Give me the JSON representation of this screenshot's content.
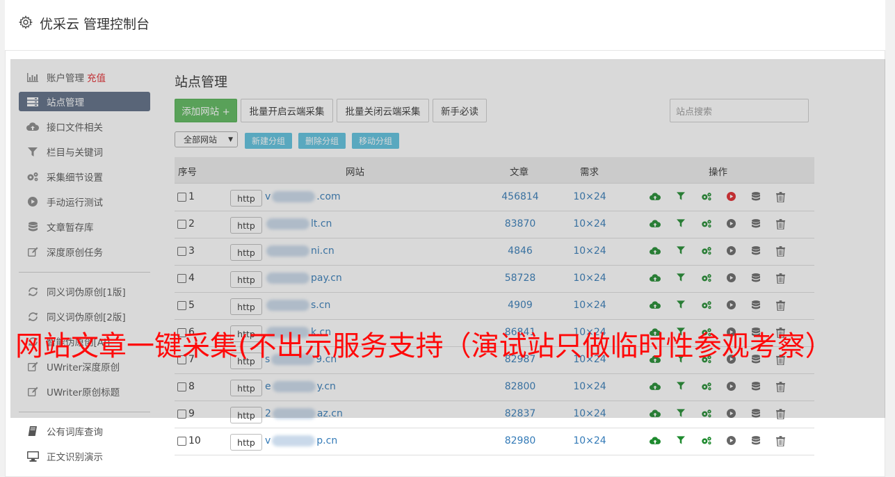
{
  "header": {
    "title": "优采云 管理控制台",
    "icon": "gear-icon"
  },
  "sidebar": {
    "items": [
      {
        "label": "账户管理",
        "badge": "充值",
        "icon": "bar-chart-icon"
      },
      {
        "label": "站点管理",
        "icon": "server-icon",
        "active": true
      },
      {
        "label": "接口文件相关",
        "icon": "cloud-upload-icon"
      },
      {
        "label": "栏目与关键词",
        "icon": "filter-icon"
      },
      {
        "label": "采集细节设置",
        "icon": "cogs-icon"
      },
      {
        "label": "手动运行测试",
        "icon": "play-icon"
      },
      {
        "label": "文章暂存库",
        "icon": "database-icon"
      },
      {
        "label": "深度原创任务",
        "icon": "edit-icon"
      },
      {
        "label": "同义词伪原创[1版]",
        "icon": "refresh-icon"
      },
      {
        "label": "同义词伪原创[2版]",
        "icon": "refresh-icon"
      },
      {
        "label": "智能伪原创[AI]",
        "icon": "refresh-icon"
      },
      {
        "label": "UWriter深度原创",
        "icon": "edit-icon"
      },
      {
        "label": "UWriter原创标题",
        "icon": "edit-icon"
      },
      {
        "label": "公有词库查询",
        "icon": "book-icon"
      },
      {
        "label": "正文识别演示",
        "icon": "monitor-icon"
      }
    ]
  },
  "main": {
    "title": "站点管理",
    "buttons": {
      "add_site": "添加网站 +",
      "batch_open": "批量开启云端采集",
      "batch_close": "批量关闭云端采集",
      "newbie": "新手必读"
    },
    "search_placeholder": "站点搜索",
    "group_select": "全部网站",
    "group_buttons": {
      "new": "新建分组",
      "delete": "删除分组",
      "move": "移动分组"
    },
    "columns": [
      "序号",
      "网站",
      "文章",
      "需求",
      "操作"
    ],
    "rows": [
      {
        "no": "1",
        "scheme": "http",
        "prefix": "v",
        "suffix": ".com",
        "articles": "456814",
        "demand": "10×24",
        "running": true
      },
      {
        "no": "2",
        "scheme": "http",
        "prefix": "",
        "suffix": "lt.cn",
        "articles": "83870",
        "demand": "10×24",
        "running": false
      },
      {
        "no": "3",
        "scheme": "http",
        "prefix": "",
        "suffix": "ni.cn",
        "articles": "4846",
        "demand": "10×24",
        "running": false
      },
      {
        "no": "4",
        "scheme": "http",
        "prefix": "",
        "suffix": "pay.cn",
        "articles": "58728",
        "demand": "10×24",
        "running": false
      },
      {
        "no": "5",
        "scheme": "http",
        "prefix": "",
        "suffix": "s.cn",
        "articles": "4909",
        "demand": "10×24",
        "running": false
      },
      {
        "no": "6",
        "scheme": "http",
        "prefix": "",
        "suffix": "k.cn",
        "articles": "86841",
        "demand": "10×24",
        "running": false
      },
      {
        "no": "7",
        "scheme": "http",
        "prefix": "s",
        "suffix": "9.cn",
        "articles": "82987",
        "demand": "10×24",
        "running": false
      },
      {
        "no": "8",
        "scheme": "http",
        "prefix": "e",
        "suffix": "y.cn",
        "articles": "82800",
        "demand": "10×24",
        "running": false
      },
      {
        "no": "9",
        "scheme": "http",
        "prefix": "2",
        "suffix": "az.cn",
        "articles": "82837",
        "demand": "10×24",
        "running": false
      },
      {
        "no": "10",
        "scheme": "http",
        "prefix": "v",
        "suffix": "p.cn",
        "articles": "82980",
        "demand": "10×24",
        "running": false
      }
    ]
  },
  "banner": "网站文章一键采集(不出示服务支持（演试站只做临时性参观考察）",
  "colors": {
    "active_sidebar": "#5c6b83",
    "green": "#5cb85c",
    "link": "#337ab7",
    "banner": "#ff0a0a",
    "run_red": "#e0262b"
  }
}
